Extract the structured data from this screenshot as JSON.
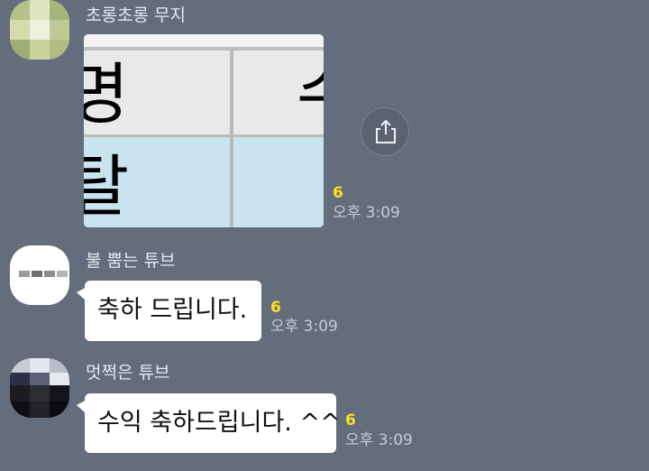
{
  "messages": [
    {
      "sender": "초롱초롱 무지",
      "type": "image",
      "image_text": {
        "header": "명",
        "header_partial": "수",
        "cell": "탈"
      },
      "unread": "6",
      "time": "오후 3:09"
    },
    {
      "sender": "불 뿜는 튜브",
      "type": "text",
      "text": "축하 드립니다.",
      "unread": "6",
      "time": "오후 3:09"
    },
    {
      "sender": "멋쩍은 튜브",
      "type": "text",
      "text": "수익 축하드립니다. ^^",
      "unread": "6",
      "time": "오후 3:09"
    }
  ],
  "icons": {
    "share": "share-icon"
  },
  "colors": {
    "background": "#646d7c",
    "bubble": "#ffffff",
    "unread": "#ffe11b",
    "time": "#c6cbd3"
  }
}
